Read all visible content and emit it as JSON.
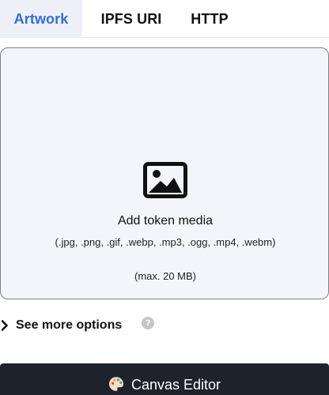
{
  "tabs": [
    {
      "label": "Artwork",
      "active": true
    },
    {
      "label": "IPFS URI",
      "active": false
    },
    {
      "label": "HTTP",
      "active": false
    }
  ],
  "dropzone": {
    "icon": "image-icon",
    "title": "Add token media",
    "formats": "(.jpg, .png, .gif, .webp, .mp3, .ogg, .mp4, .webm)",
    "max_size": "(max. 20 MB)"
  },
  "more_options": {
    "label": "See more options",
    "expand_icon": "chevron-right-icon",
    "help_icon": "question-mark-icon",
    "help_glyph": "?"
  },
  "canvas_editor": {
    "label": "Canvas Editor",
    "icon": "palette-icon"
  },
  "colors": {
    "accent": "#2f6fde",
    "active_tab_bg": "#eef0f8",
    "dropzone_bg": "#f4f5fb",
    "button_bg": "#1e222b"
  }
}
